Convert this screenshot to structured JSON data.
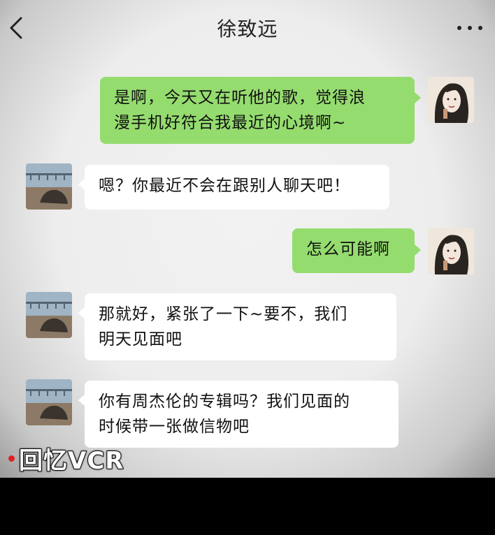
{
  "header": {
    "title": "徐致远",
    "back_icon": "chevron-left-icon",
    "more_icon": "ellipsis-icon"
  },
  "messages": [
    {
      "side": "sent",
      "text": "是啊，今天又在听他的歌，觉得浪\n漫手机好符合我最近的心境啊~"
    },
    {
      "side": "received",
      "text": "嗯？你最近不会在跟别人聊天吧！"
    },
    {
      "side": "sent",
      "text": "怎么可能啊"
    },
    {
      "side": "received",
      "text": "那就好，紧张了一下~要不，我们\n明天见面吧"
    },
    {
      "side": "received",
      "text": "你有周杰伦的专辑吗？我们见面的\n时候带一张做信物吧"
    }
  ],
  "watermark": {
    "text": "回忆VCR",
    "dot_color": "#e02020"
  },
  "colors": {
    "sent_bubble": "#95dc6f",
    "received_bubble": "#ffffff",
    "background": "#ededed"
  }
}
